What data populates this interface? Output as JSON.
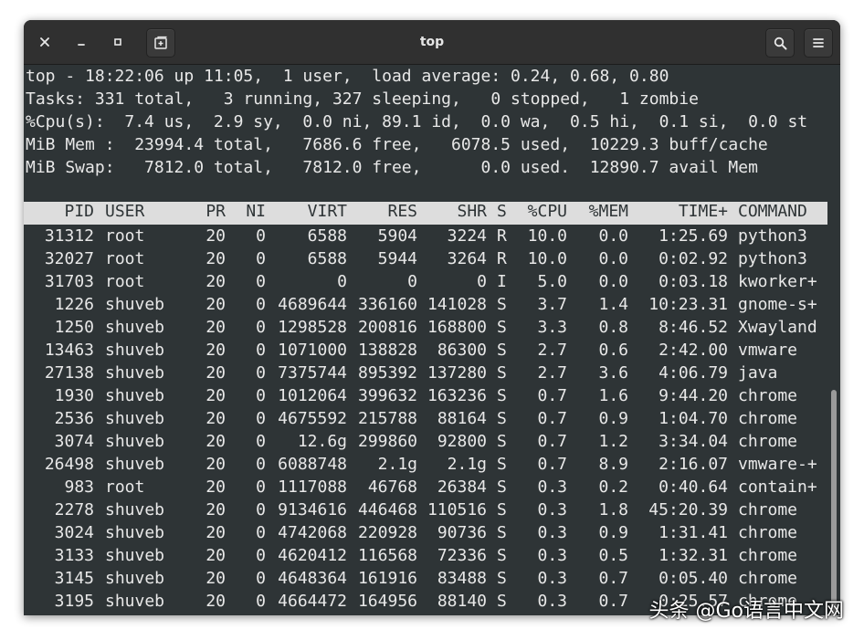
{
  "window": {
    "title": "top"
  },
  "summary": [
    "top - 18:22:06 up 11:05,  1 user,  load average: 0.24, 0.68, 0.80",
    "Tasks: 331 total,   3 running, 327 sleeping,   0 stopped,   1 zombie",
    "%Cpu(s):  7.4 us,  2.9 sy,  0.0 ni, 89.1 id,  0.0 wa,  0.5 hi,  0.1 si,  0.0 st",
    "MiB Mem :  23994.4 total,   7686.6 free,   6078.5 used,  10229.3 buff/cache",
    "MiB Swap:   7812.0 total,   7812.0 free,      0.0 used.  12890.7 avail Mem"
  ],
  "columns": [
    "PID",
    "USER",
    "PR",
    "NI",
    "VIRT",
    "RES",
    "SHR",
    "S",
    "%CPU",
    "%MEM",
    "TIME+",
    "COMMAND"
  ],
  "processes": [
    [
      "31312",
      "root",
      "20",
      "0",
      "6588",
      "5904",
      "3224",
      "R",
      "10.0",
      "0.0",
      "1:25.69",
      "python3"
    ],
    [
      "32027",
      "root",
      "20",
      "0",
      "6588",
      "5944",
      "3264",
      "R",
      "10.0",
      "0.0",
      "0:02.92",
      "python3"
    ],
    [
      "31703",
      "root",
      "20",
      "0",
      "0",
      "0",
      "0",
      "I",
      "5.0",
      "0.0",
      "0:03.18",
      "kworker+"
    ],
    [
      "1226",
      "shuveb",
      "20",
      "0",
      "4689644",
      "336160",
      "141028",
      "S",
      "3.7",
      "1.4",
      "10:23.31",
      "gnome-s+"
    ],
    [
      "1250",
      "shuveb",
      "20",
      "0",
      "1298528",
      "200816",
      "168800",
      "S",
      "3.3",
      "0.8",
      "8:46.52",
      "Xwayland"
    ],
    [
      "13463",
      "shuveb",
      "20",
      "0",
      "1071000",
      "138828",
      "86300",
      "S",
      "2.7",
      "0.6",
      "2:42.00",
      "vmware"
    ],
    [
      "27138",
      "shuveb",
      "20",
      "0",
      "7375744",
      "895392",
      "137280",
      "S",
      "2.7",
      "3.6",
      "4:06.79",
      "java"
    ],
    [
      "1930",
      "shuveb",
      "20",
      "0",
      "1012064",
      "399632",
      "163236",
      "S",
      "0.7",
      "1.6",
      "9:44.20",
      "chrome"
    ],
    [
      "2536",
      "shuveb",
      "20",
      "0",
      "4675592",
      "215788",
      "88164",
      "S",
      "0.7",
      "0.9",
      "1:04.70",
      "chrome"
    ],
    [
      "3074",
      "shuveb",
      "20",
      "0",
      "12.6g",
      "299860",
      "92800",
      "S",
      "0.7",
      "1.2",
      "3:34.04",
      "chrome"
    ],
    [
      "26498",
      "shuveb",
      "20",
      "0",
      "6088748",
      "2.1g",
      "2.1g",
      "S",
      "0.7",
      "8.9",
      "2:16.07",
      "vmware-+"
    ],
    [
      "983",
      "root",
      "20",
      "0",
      "1117088",
      "46768",
      "26384",
      "S",
      "0.3",
      "0.2",
      "0:40.64",
      "contain+"
    ],
    [
      "2278",
      "shuveb",
      "20",
      "0",
      "9134616",
      "446468",
      "110516",
      "S",
      "0.3",
      "1.8",
      "45:20.39",
      "chrome"
    ],
    [
      "3024",
      "shuveb",
      "20",
      "0",
      "4742068",
      "220928",
      "90736",
      "S",
      "0.3",
      "0.9",
      "1:31.41",
      "chrome"
    ],
    [
      "3133",
      "shuveb",
      "20",
      "0",
      "4620412",
      "116568",
      "72336",
      "S",
      "0.3",
      "0.5",
      "1:32.31",
      "chrome"
    ],
    [
      "3145",
      "shuveb",
      "20",
      "0",
      "4648364",
      "161916",
      "83488",
      "S",
      "0.3",
      "0.7",
      "0:05.40",
      "chrome"
    ],
    [
      "3195",
      "shuveb",
      "20",
      "0",
      "4664472",
      "164956",
      "88140",
      "S",
      "0.3",
      "0.7",
      "0:25.57",
      "chrome"
    ]
  ],
  "watermark": "头条 @Go语言中文网",
  "colors": {
    "terminal_bg": "#2e3436",
    "terminal_fg": "#e8e8e8",
    "header_bg": "#dddddd",
    "titlebar_bg": "#303030"
  },
  "icons": {
    "close": "close-icon",
    "minimize": "minimize-icon",
    "maximize": "maximize-icon",
    "new_tab": "new-tab-icon",
    "search": "search-icon",
    "menu": "hamburger-menu-icon"
  }
}
